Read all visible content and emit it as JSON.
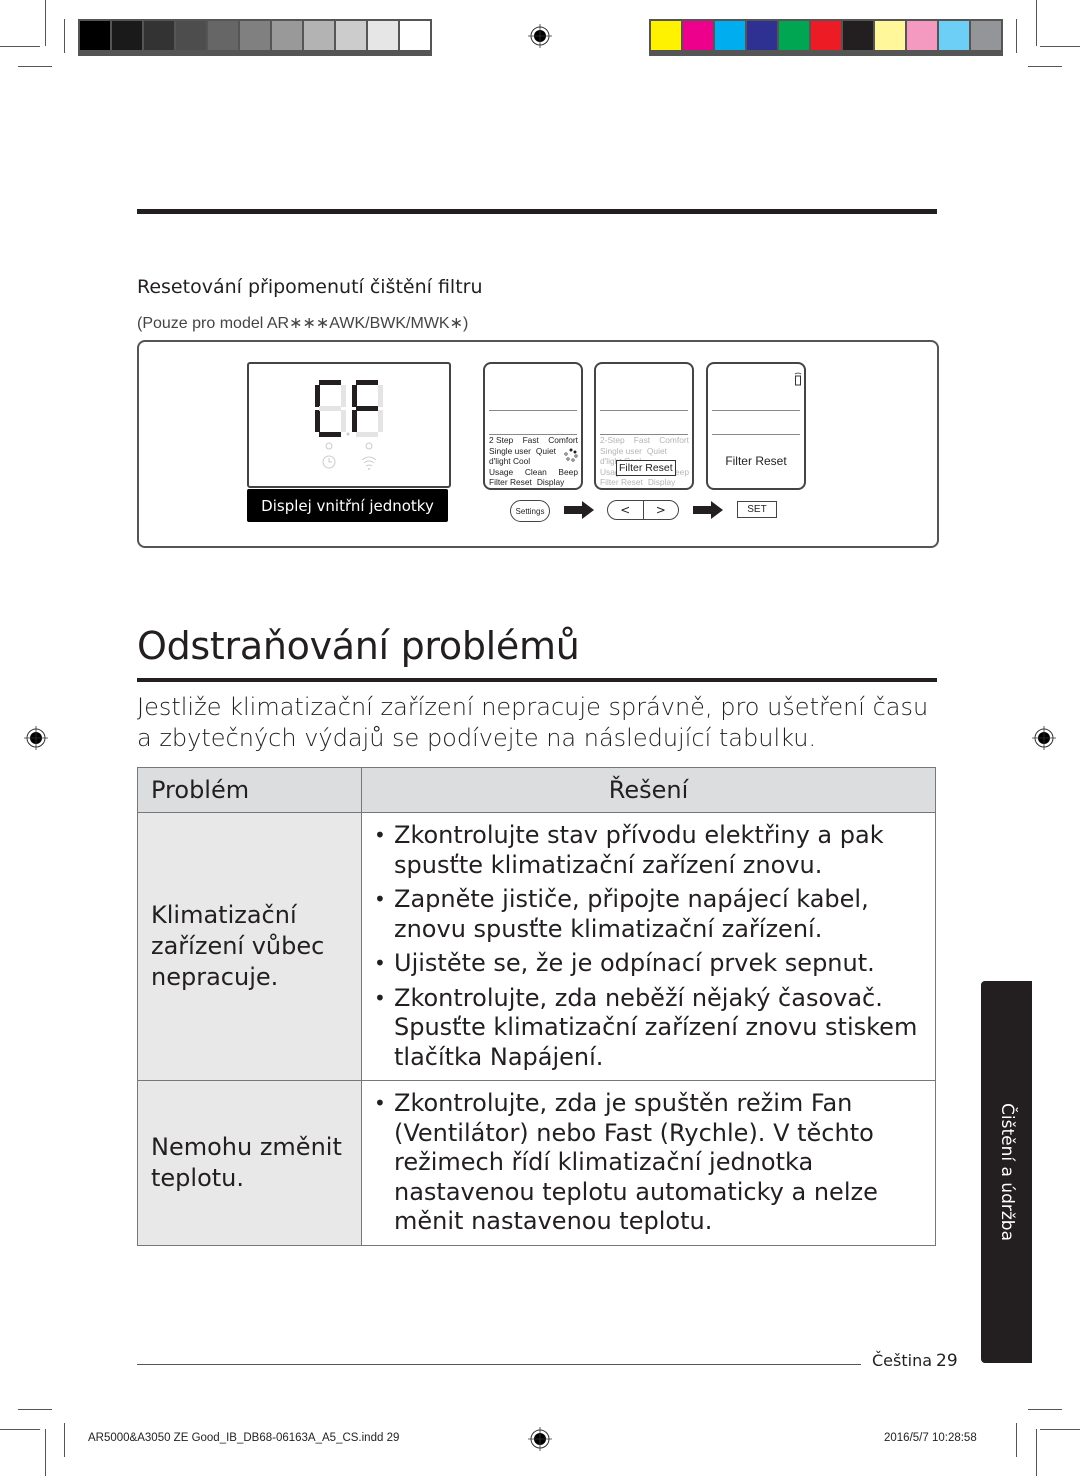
{
  "print_marks": {
    "gray_swatches": [
      "#000000",
      "#1a1a1a",
      "#333333",
      "#4d4d4d",
      "#666666",
      "#808080",
      "#999999",
      "#b3b3b3",
      "#cccccc",
      "#e6e6e6",
      "#ffffff"
    ],
    "color_swatches": [
      "#fff200",
      "#ec008c",
      "#00aeef",
      "#2e3192",
      "#00a651",
      "#ed1c24",
      "#231f20",
      "#fff799",
      "#f49ac1",
      "#6dcff6",
      "#939598"
    ]
  },
  "filter_section": {
    "heading": "Resetování připomenutí čištění filtru",
    "model_note": "(Pouze pro model AR∗∗∗AWK/BWK/MWK∗)",
    "indoor_display": {
      "code": "CF",
      "label": "Displej vnitřní jednotky"
    },
    "remote_menu": {
      "rows": [
        [
          "2 Step",
          "Fast",
          "Comfort"
        ],
        [
          "Single user",
          "Quiet"
        ],
        [
          "d'light Cool"
        ],
        [
          "Usage",
          "Clean",
          "Beep"
        ],
        [
          "Filter Reset",
          "Display"
        ]
      ],
      "faded_rows": [
        [
          "2-Step",
          "Fast",
          "Comfort"
        ],
        [
          "Single user",
          "Quiet"
        ],
        [
          "d'light Cool"
        ],
        [
          "Usage",
          "Clean",
          "Beep"
        ],
        [
          "Filter Reset",
          "Display"
        ]
      ],
      "selected_item": "Filter Reset",
      "final_screen_text": "Filter Reset"
    },
    "buttons": {
      "settings": "Settings",
      "left": "<",
      "right": ">",
      "set": "SET"
    }
  },
  "troubleshooting": {
    "title": "Odstraňování problémů",
    "intro": "Jestliže klimatizační zařízení nepracuje správně, pro ušetření času a zbytečných výdajů se podívejte na následující tabulku.",
    "table": {
      "headers": [
        "Problém",
        "Řešení"
      ],
      "rows": [
        {
          "problem": "Klimatizační zařízení vůbec nepracuje.",
          "solutions": [
            "Zkontrolujte stav přívodu elektřiny a pak spusťte klimatizační zařízení znovu.",
            "Zapněte jističe, připojte napájecí kabel, znovu spusťte klimatizační zařízení.",
            "Ujistěte se, že je odpínací prvek sepnut.",
            "Zkontrolujte, zda neběží nějaký časovač. Spusťte klimatizační zařízení znovu stiskem tlačítka Napájení."
          ]
        },
        {
          "problem": "Nemohu změnit teplotu.",
          "solutions": [
            "Zkontrolujte, zda je spuštěn režim Fan (Ventilátor) nebo Fast (Rychle). V těchto režimech řídí klimatizační jednotka nastavenou teplotu automaticky a nelze měnit nastavenou teplotu."
          ]
        }
      ]
    }
  },
  "side_tab": "Čištění a údržba",
  "footer": {
    "language": "Čeština",
    "page_number": "29",
    "slug_file": "AR5000&A3050 ZE Good_IB_DB68-06163A_A5_CS.indd   29",
    "slug_date": "2016/5/7   10:28:58"
  }
}
